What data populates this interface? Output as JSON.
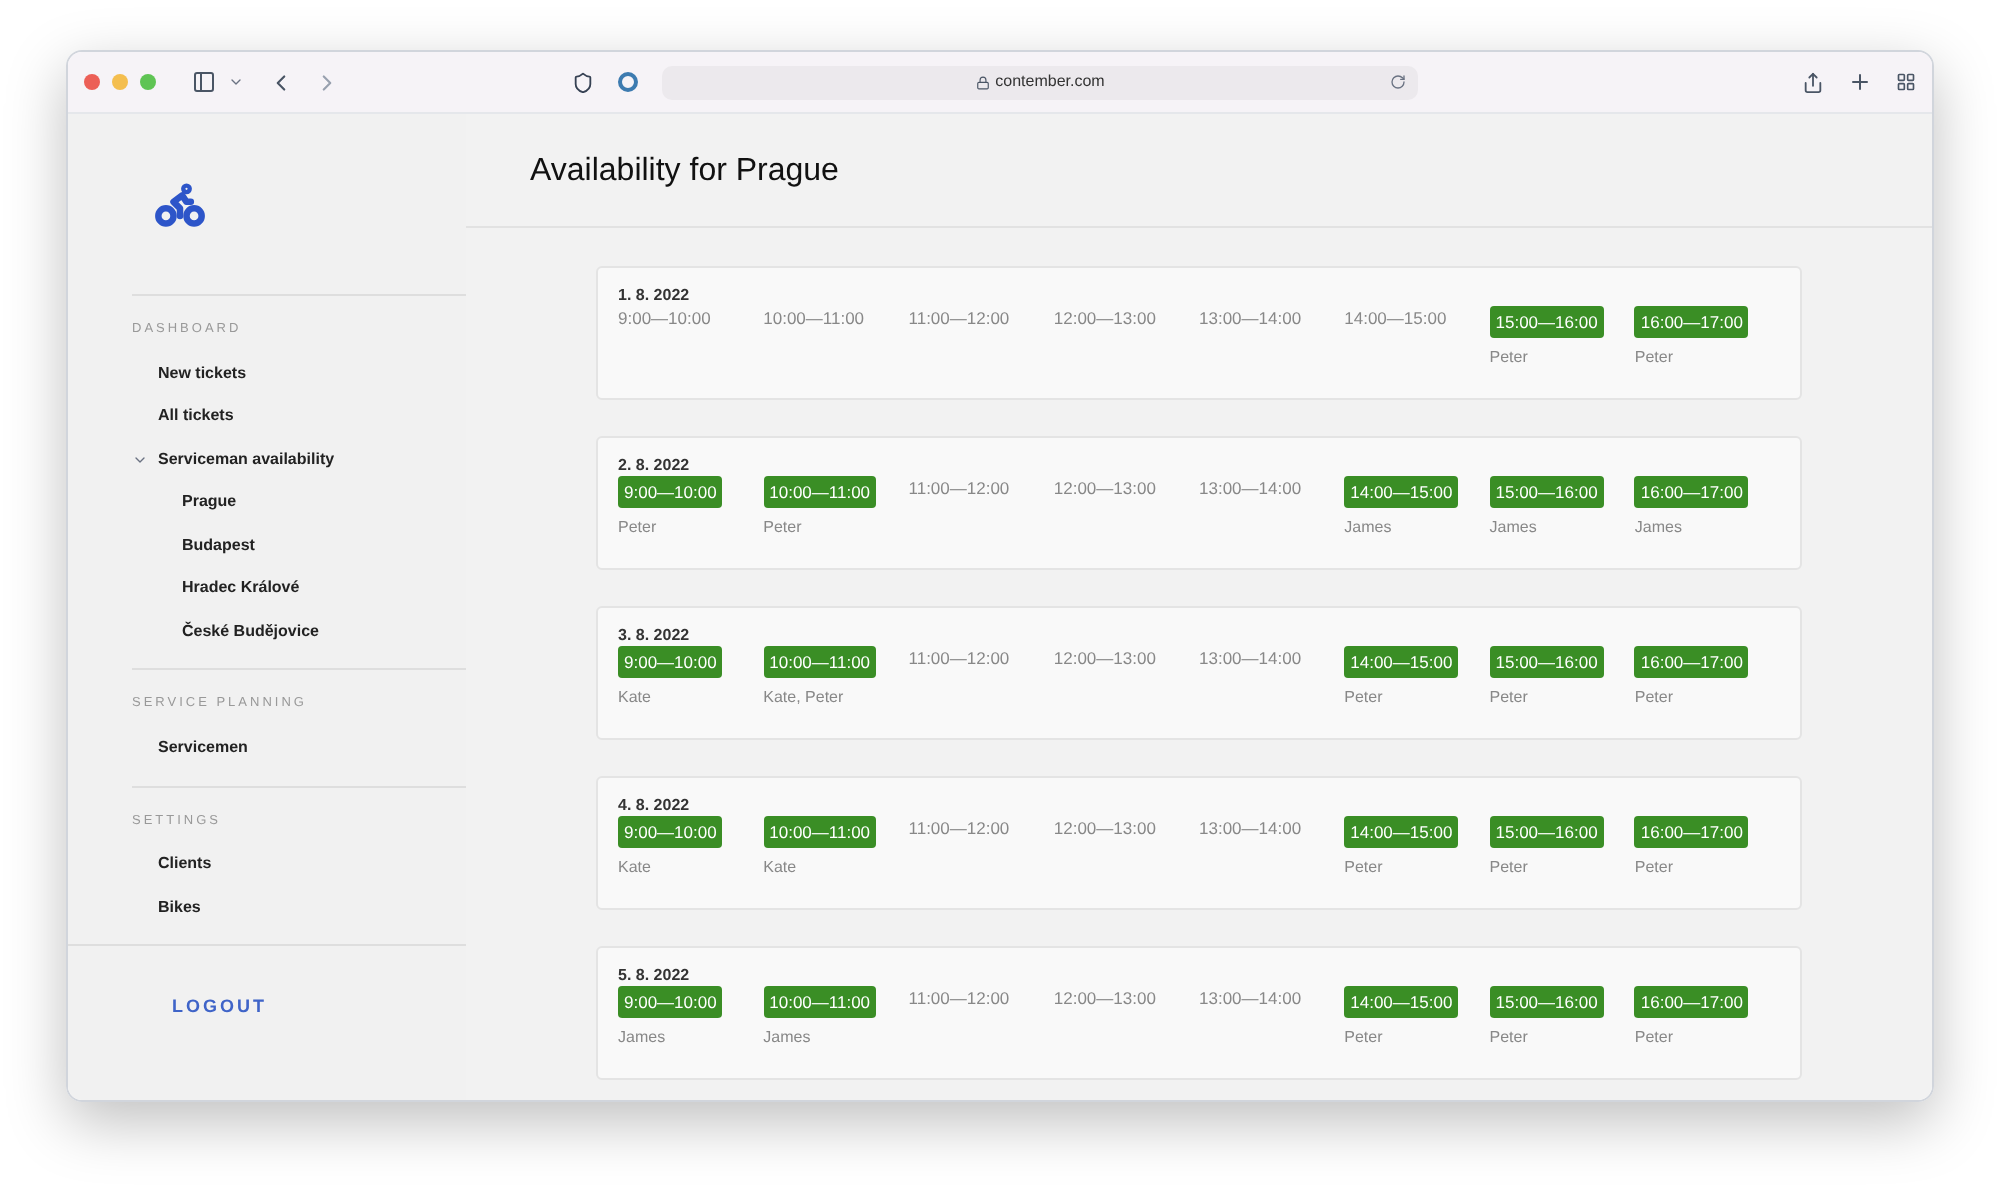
{
  "browser": {
    "url": "contember.com"
  },
  "sidebar": {
    "sections": [
      {
        "heading": "DASHBOARD",
        "items": [
          {
            "label": "New tickets"
          },
          {
            "label": "All tickets"
          },
          {
            "label": "Serviceman availability",
            "expanded": true,
            "children": [
              {
                "label": "Prague"
              },
              {
                "label": "Budapest"
              },
              {
                "label": "Hradec Králové"
              },
              {
                "label": "České Budějovice"
              }
            ]
          }
        ]
      },
      {
        "heading": "SERVICE PLANNING",
        "items": [
          {
            "label": "Servicemen"
          }
        ]
      },
      {
        "heading": "SETTINGS",
        "items": [
          {
            "label": "Clients"
          },
          {
            "label": "Bikes"
          }
        ]
      }
    ],
    "logout": "LOGOUT"
  },
  "title": "Availability for Prague",
  "days": [
    {
      "date": "1. 8. 2022",
      "slots": [
        {
          "time": "9:00—10:00",
          "available": false
        },
        {
          "time": "10:00—11:00",
          "available": false
        },
        {
          "time": "11:00—12:00",
          "available": false
        },
        {
          "time": "12:00—13:00",
          "available": false
        },
        {
          "time": "13:00—14:00",
          "available": false
        },
        {
          "time": "14:00—15:00",
          "available": false
        },
        {
          "time": "15:00—16:00",
          "available": true,
          "people": "Peter"
        },
        {
          "time": "16:00—17:00",
          "available": true,
          "people": "Peter"
        }
      ]
    },
    {
      "date": "2. 8. 2022",
      "slots": [
        {
          "time": "9:00—10:00",
          "available": true,
          "people": "Peter"
        },
        {
          "time": "10:00—11:00",
          "available": true,
          "people": "Peter"
        },
        {
          "time": "11:00—12:00",
          "available": false
        },
        {
          "time": "12:00—13:00",
          "available": false
        },
        {
          "time": "13:00—14:00",
          "available": false
        },
        {
          "time": "14:00—15:00",
          "available": true,
          "people": "James"
        },
        {
          "time": "15:00—16:00",
          "available": true,
          "people": "James"
        },
        {
          "time": "16:00—17:00",
          "available": true,
          "people": "James"
        }
      ]
    },
    {
      "date": "3. 8. 2022",
      "slots": [
        {
          "time": "9:00—10:00",
          "available": true,
          "people": "Kate"
        },
        {
          "time": "10:00—11:00",
          "available": true,
          "people": "Kate, Peter"
        },
        {
          "time": "11:00—12:00",
          "available": false
        },
        {
          "time": "12:00—13:00",
          "available": false
        },
        {
          "time": "13:00—14:00",
          "available": false
        },
        {
          "time": "14:00—15:00",
          "available": true,
          "people": "Peter"
        },
        {
          "time": "15:00—16:00",
          "available": true,
          "people": "Peter"
        },
        {
          "time": "16:00—17:00",
          "available": true,
          "people": "Peter"
        }
      ]
    },
    {
      "date": "4. 8. 2022",
      "slots": [
        {
          "time": "9:00—10:00",
          "available": true,
          "people": "Kate"
        },
        {
          "time": "10:00—11:00",
          "available": true,
          "people": "Kate"
        },
        {
          "time": "11:00—12:00",
          "available": false
        },
        {
          "time": "12:00—13:00",
          "available": false
        },
        {
          "time": "13:00—14:00",
          "available": false
        },
        {
          "time": "14:00—15:00",
          "available": true,
          "people": "Peter"
        },
        {
          "time": "15:00—16:00",
          "available": true,
          "people": "Peter"
        },
        {
          "time": "16:00—17:00",
          "available": true,
          "people": "Peter"
        }
      ]
    },
    {
      "date": "5. 8. 2022",
      "slots": [
        {
          "time": "9:00—10:00",
          "available": true,
          "people": "James"
        },
        {
          "time": "10:00—11:00",
          "available": true,
          "people": "James"
        },
        {
          "time": "11:00—12:00",
          "available": false
        },
        {
          "time": "12:00—13:00",
          "available": false
        },
        {
          "time": "13:00—14:00",
          "available": false
        },
        {
          "time": "14:00—15:00",
          "available": true,
          "people": "Peter"
        },
        {
          "time": "15:00—16:00",
          "available": true,
          "people": "Peter"
        },
        {
          "time": "16:00—17:00",
          "available": true,
          "people": "Peter"
        }
      ]
    }
  ]
}
